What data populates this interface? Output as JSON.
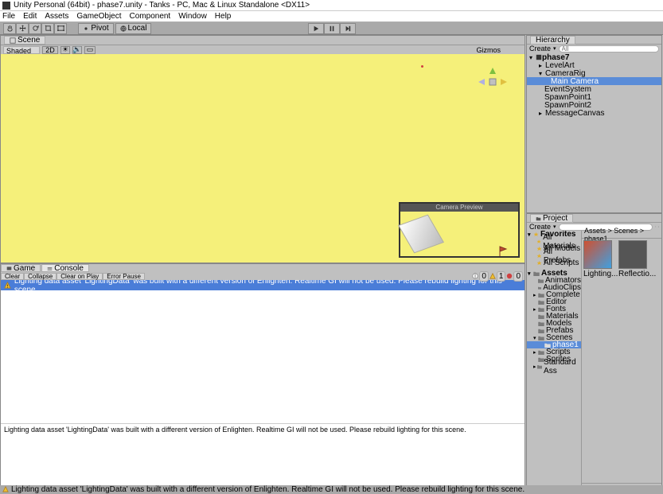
{
  "window": {
    "title": "Unity Personal (64bit) - phase7.unity - Tanks - PC, Mac & Linux Standalone <DX11>"
  },
  "menu": {
    "items": [
      "File",
      "Edit",
      "Assets",
      "GameObject",
      "Component",
      "Window",
      "Help"
    ]
  },
  "toolbar": {
    "pivot": "Pivot",
    "local": "Local"
  },
  "scene": {
    "tab": "Scene",
    "shading": "Shaded",
    "twod": "2D",
    "gizmos": "Gizmos",
    "camera_preview_label": "Camera Preview"
  },
  "hierarchy": {
    "tab": "Hierarchy",
    "create": "Create",
    "search_placeholder": "All",
    "root": "phase7",
    "items": [
      "LevelArt",
      "CameraRig",
      "Main Camera",
      "EventSystem",
      "SpawnPoint1",
      "SpawnPoint2",
      "MessageCanvas"
    ]
  },
  "console": {
    "game_tab": "Game",
    "console_tab": "Console",
    "clear": "Clear",
    "collapse": "Collapse",
    "clear_on_play": "Clear on Play",
    "error_pause": "Error Pause",
    "counts": {
      "info": "0",
      "warn": "1",
      "error": "0"
    },
    "message": "Lighting data asset 'LightingData' was built with a different version of Enlighten. Realtime GI will not be used. Please rebuild lighting for this scene.",
    "detail": "Lighting data asset 'LightingData' was built with a different version of Enlighten. Realtime GI will not be used. Please rebuild lighting for this scene."
  },
  "project": {
    "tab": "Project",
    "create": "Create",
    "breadcrumb": "Assets > Scenes > phase1",
    "favorites_label": "Favorites",
    "favorites": [
      "All Materials",
      "All Models",
      "All Prefabs",
      "All Scripts"
    ],
    "assets_label": "Assets",
    "tree": [
      "Animators",
      "AudioClips",
      "Complete",
      "Editor",
      "Fonts",
      "Materials",
      "Models",
      "Prefabs",
      "Scenes",
      "phase1",
      "Scripts",
      "Sprites",
      "Standard Ass"
    ],
    "thumbs": [
      "Lighting...",
      "Reflectio..."
    ]
  },
  "statusbar": {
    "message": "Lighting data asset 'LightingData' was built with a different version of Enlighten. Realtime GI will not be used. Please rebuild lighting for this scene."
  }
}
